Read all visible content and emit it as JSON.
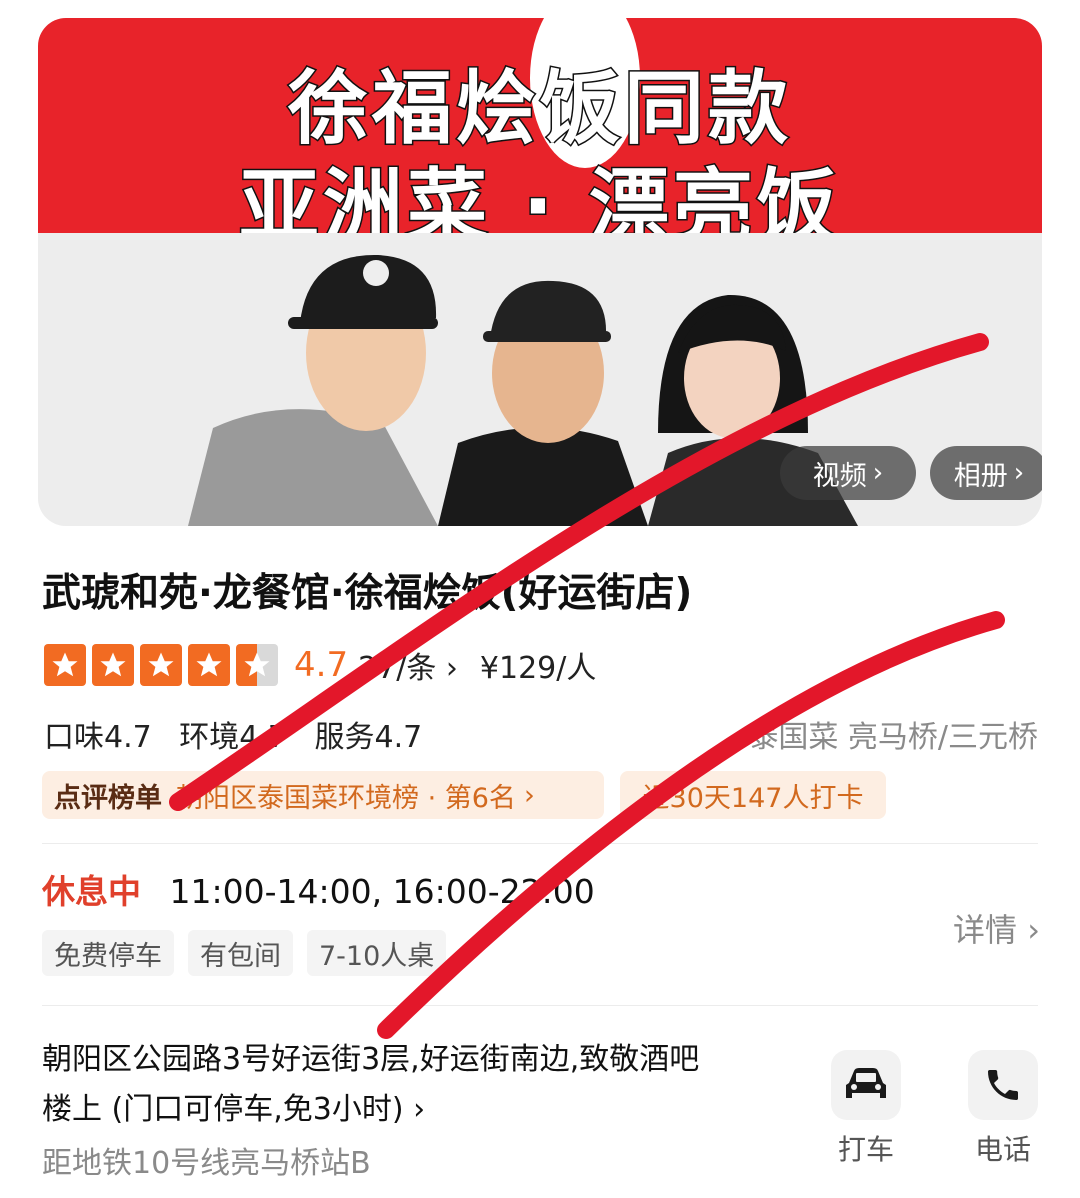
{
  "hero": {
    "headline_line1": "徐福烩饭同款",
    "headline_line2": "亚洲菜 · 漂亮饭",
    "video_button": "视频",
    "album_button": "相册"
  },
  "shop": {
    "name": "武琥和苑·龙餐馆·徐福烩饭(好运街店)",
    "rating": "4.7",
    "rating_stars": 4.5,
    "review_count": "27/条",
    "price": "¥129/人",
    "sub_scores": [
      "口味4.7",
      "环境4.7",
      "服务4.7"
    ],
    "area": "泰国菜 亮马桥/三元桥"
  },
  "rank": {
    "tag": "点评榜单",
    "text": "朝阳区泰国菜环境榜 · 第6名",
    "checkin": "近30天147人打卡"
  },
  "hours": {
    "status": "休息中",
    "times": "11:00-14:00, 16:00-22:00",
    "tags": [
      "免费停车",
      "有包间",
      "7-10人桌"
    ],
    "detail_link": "详情"
  },
  "location": {
    "address": "朝阳区公园路3号好运街3层,好运街南边,致敬酒吧楼上 (门口可停车,免3小时)",
    "metro": "距地铁10号线亮马桥站B"
  },
  "actions": {
    "taxi": "打车",
    "phone": "电话"
  },
  "colors": {
    "brand_orange": "#f26b22",
    "banner_red": "#e8232a",
    "status_red": "#e0402b",
    "scribble_red": "#e3172a"
  }
}
